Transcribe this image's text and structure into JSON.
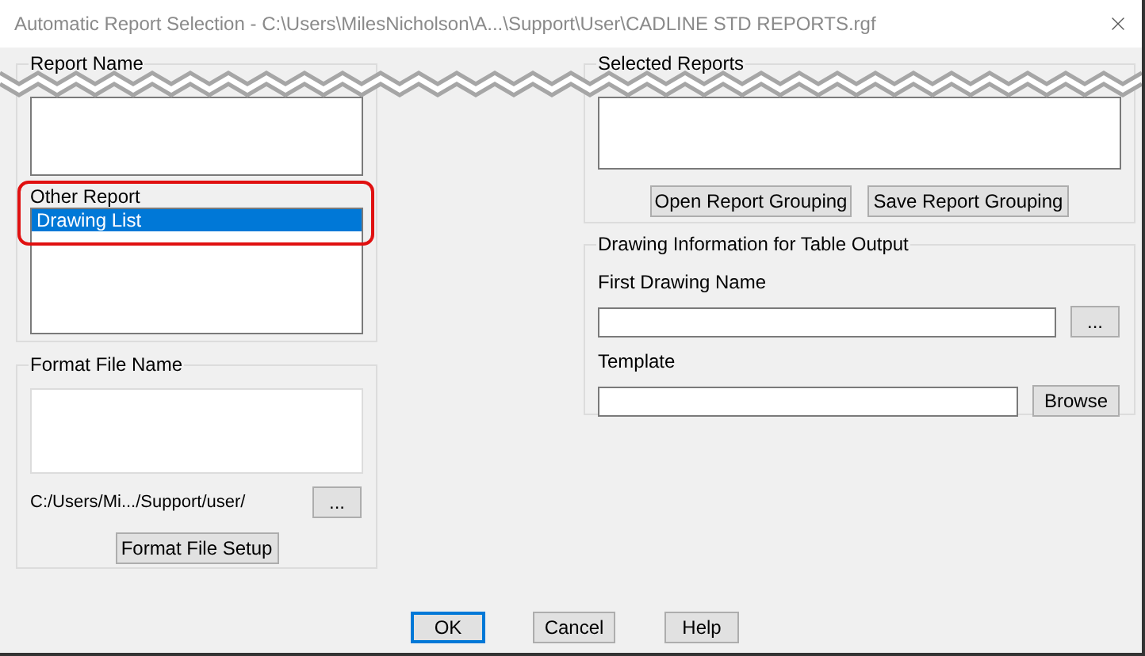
{
  "window": {
    "title": "Automatic Report Selection - C:\\Users\\MilesNicholson\\A...\\Support\\User\\CADLINE STD REPORTS.rgf"
  },
  "report_name": {
    "label": "Report Name"
  },
  "other_report": {
    "label": "Other Report",
    "items": [
      {
        "label": "Drawing List",
        "selected": true
      }
    ]
  },
  "format_file": {
    "label": "Format File Name",
    "path": "C:/Users/Mi.../Support/user/",
    "browse_button": "...",
    "setup_button": "Format File Setup"
  },
  "selected_reports": {
    "label": "Selected Reports",
    "buttons": [
      "Open Report Grouping",
      "Save Report Grouping"
    ]
  },
  "drawing_info": {
    "label": "Drawing Information for Table Output",
    "first_drawing_name": {
      "label": "First Drawing Name",
      "button": "..."
    },
    "template": {
      "label": "Template",
      "button": "Browse"
    }
  },
  "buttons": [
    {
      "label": "OK",
      "default": true
    },
    {
      "label": "Cancel",
      "default": false
    },
    {
      "label": "Help",
      "default": false
    }
  ]
}
